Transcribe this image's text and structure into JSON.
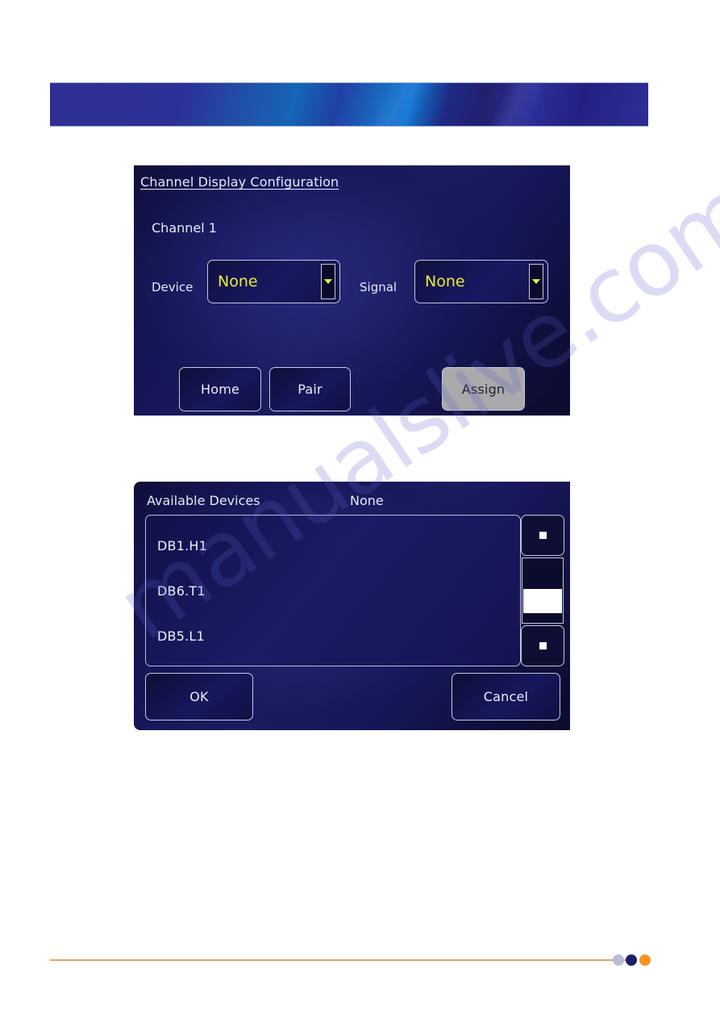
{
  "page": {
    "watermark_text": "manualslive.com",
    "background_color": "#ffffff"
  },
  "banner": {
    "name": "decorative-header-banner",
    "colors": [
      "#2e2f93",
      "#1564b8",
      "#0f77d0",
      "#221f6d"
    ]
  },
  "channel_config": {
    "title": "Channel Display Configuration",
    "channel_label": "Channel 1",
    "device": {
      "label": "Device",
      "value": "None",
      "value_color": "#eaea3c"
    },
    "signal": {
      "label": "Signal",
      "value": "None",
      "value_color": "#eaea3c"
    },
    "buttons": {
      "home": "Home",
      "pair": "Pair",
      "assign": "Assign",
      "assign_color": "#a9a9ab"
    }
  },
  "available_devices": {
    "header_label": "Available Devices",
    "header_value": "None",
    "devices": [
      {
        "name": "DB1.H1"
      },
      {
        "name": "DB6.T1"
      },
      {
        "name": "DB5.L1"
      }
    ],
    "scrollbar": {
      "up_icon": "square-up-icon",
      "down_icon": "square-down-icon"
    },
    "buttons": {
      "ok": "OK",
      "cancel": "Cancel"
    }
  },
  "footer": {
    "rule_color": "#f0a060",
    "dots": [
      {
        "color": "#b8bdd4"
      },
      {
        "color": "#1a2166"
      },
      {
        "color": "#f7931e"
      }
    ]
  }
}
